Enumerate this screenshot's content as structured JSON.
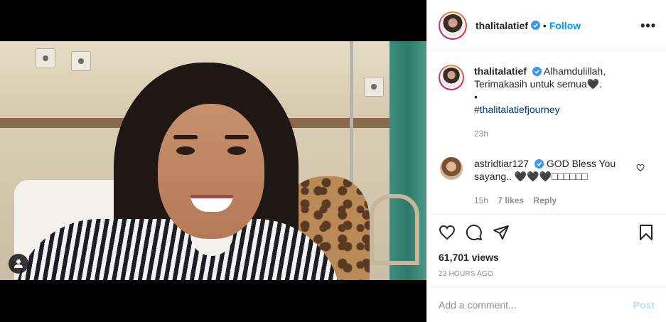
{
  "post": {
    "author": "thalitalatief",
    "follow_label": "Follow",
    "separator": "•",
    "more_label": "•••"
  },
  "caption": {
    "username": "thalitalatief",
    "line1": "Alhamdulillah,",
    "line2": "Terimakasih untuk semua",
    "heart": "🖤.",
    "bullet": "•",
    "hashtag": "#thalitalatiefjourney",
    "time": "23h"
  },
  "comment": {
    "username": "astridtiar127",
    "text": "GOD Bless You sayang.. ",
    "hearts": "🖤🖤🖤□□□□□□",
    "time": "15h",
    "likes": "7 likes",
    "reply_label": "Reply"
  },
  "stats": {
    "views": "61,701 views",
    "posted": "23 HOURS AGO"
  },
  "composer": {
    "placeholder": "Add a comment...",
    "post_label": "Post"
  },
  "colors": {
    "accent": "#0095f6",
    "verified": "#3897f0",
    "hashtag": "#00376b",
    "muted": "#8e8e8e"
  },
  "icons": [
    "user-tag-icon",
    "verified-badge-icon",
    "more-options-icon",
    "heart-icon",
    "comment-icon",
    "share-icon",
    "bookmark-icon"
  ]
}
